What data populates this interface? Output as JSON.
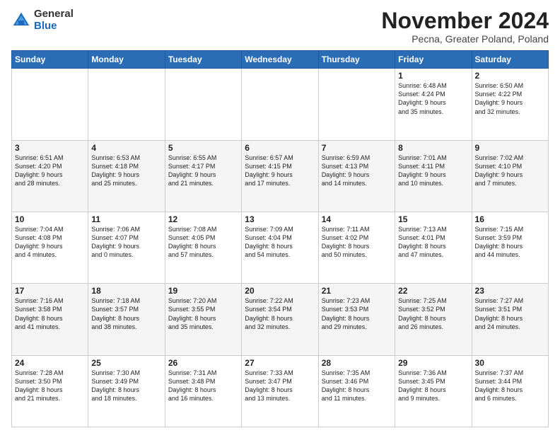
{
  "logo": {
    "general": "General",
    "blue": "Blue"
  },
  "header": {
    "month_title": "November 2024",
    "location": "Pecna, Greater Poland, Poland"
  },
  "days_of_week": [
    "Sunday",
    "Monday",
    "Tuesday",
    "Wednesday",
    "Thursday",
    "Friday",
    "Saturday"
  ],
  "weeks": [
    [
      {
        "day": "",
        "info": ""
      },
      {
        "day": "",
        "info": ""
      },
      {
        "day": "",
        "info": ""
      },
      {
        "day": "",
        "info": ""
      },
      {
        "day": "",
        "info": ""
      },
      {
        "day": "1",
        "info": "Sunrise: 6:48 AM\nSunset: 4:24 PM\nDaylight: 9 hours\nand 35 minutes."
      },
      {
        "day": "2",
        "info": "Sunrise: 6:50 AM\nSunset: 4:22 PM\nDaylight: 9 hours\nand 32 minutes."
      }
    ],
    [
      {
        "day": "3",
        "info": "Sunrise: 6:51 AM\nSunset: 4:20 PM\nDaylight: 9 hours\nand 28 minutes."
      },
      {
        "day": "4",
        "info": "Sunrise: 6:53 AM\nSunset: 4:18 PM\nDaylight: 9 hours\nand 25 minutes."
      },
      {
        "day": "5",
        "info": "Sunrise: 6:55 AM\nSunset: 4:17 PM\nDaylight: 9 hours\nand 21 minutes."
      },
      {
        "day": "6",
        "info": "Sunrise: 6:57 AM\nSunset: 4:15 PM\nDaylight: 9 hours\nand 17 minutes."
      },
      {
        "day": "7",
        "info": "Sunrise: 6:59 AM\nSunset: 4:13 PM\nDaylight: 9 hours\nand 14 minutes."
      },
      {
        "day": "8",
        "info": "Sunrise: 7:01 AM\nSunset: 4:11 PM\nDaylight: 9 hours\nand 10 minutes."
      },
      {
        "day": "9",
        "info": "Sunrise: 7:02 AM\nSunset: 4:10 PM\nDaylight: 9 hours\nand 7 minutes."
      }
    ],
    [
      {
        "day": "10",
        "info": "Sunrise: 7:04 AM\nSunset: 4:08 PM\nDaylight: 9 hours\nand 4 minutes."
      },
      {
        "day": "11",
        "info": "Sunrise: 7:06 AM\nSunset: 4:07 PM\nDaylight: 9 hours\nand 0 minutes."
      },
      {
        "day": "12",
        "info": "Sunrise: 7:08 AM\nSunset: 4:05 PM\nDaylight: 8 hours\nand 57 minutes."
      },
      {
        "day": "13",
        "info": "Sunrise: 7:09 AM\nSunset: 4:04 PM\nDaylight: 8 hours\nand 54 minutes."
      },
      {
        "day": "14",
        "info": "Sunrise: 7:11 AM\nSunset: 4:02 PM\nDaylight: 8 hours\nand 50 minutes."
      },
      {
        "day": "15",
        "info": "Sunrise: 7:13 AM\nSunset: 4:01 PM\nDaylight: 8 hours\nand 47 minutes."
      },
      {
        "day": "16",
        "info": "Sunrise: 7:15 AM\nSunset: 3:59 PM\nDaylight: 8 hours\nand 44 minutes."
      }
    ],
    [
      {
        "day": "17",
        "info": "Sunrise: 7:16 AM\nSunset: 3:58 PM\nDaylight: 8 hours\nand 41 minutes."
      },
      {
        "day": "18",
        "info": "Sunrise: 7:18 AM\nSunset: 3:57 PM\nDaylight: 8 hours\nand 38 minutes."
      },
      {
        "day": "19",
        "info": "Sunrise: 7:20 AM\nSunset: 3:55 PM\nDaylight: 8 hours\nand 35 minutes."
      },
      {
        "day": "20",
        "info": "Sunrise: 7:22 AM\nSunset: 3:54 PM\nDaylight: 8 hours\nand 32 minutes."
      },
      {
        "day": "21",
        "info": "Sunrise: 7:23 AM\nSunset: 3:53 PM\nDaylight: 8 hours\nand 29 minutes."
      },
      {
        "day": "22",
        "info": "Sunrise: 7:25 AM\nSunset: 3:52 PM\nDaylight: 8 hours\nand 26 minutes."
      },
      {
        "day": "23",
        "info": "Sunrise: 7:27 AM\nSunset: 3:51 PM\nDaylight: 8 hours\nand 24 minutes."
      }
    ],
    [
      {
        "day": "24",
        "info": "Sunrise: 7:28 AM\nSunset: 3:50 PM\nDaylight: 8 hours\nand 21 minutes."
      },
      {
        "day": "25",
        "info": "Sunrise: 7:30 AM\nSunset: 3:49 PM\nDaylight: 8 hours\nand 18 minutes."
      },
      {
        "day": "26",
        "info": "Sunrise: 7:31 AM\nSunset: 3:48 PM\nDaylight: 8 hours\nand 16 minutes."
      },
      {
        "day": "27",
        "info": "Sunrise: 7:33 AM\nSunset: 3:47 PM\nDaylight: 8 hours\nand 13 minutes."
      },
      {
        "day": "28",
        "info": "Sunrise: 7:35 AM\nSunset: 3:46 PM\nDaylight: 8 hours\nand 11 minutes."
      },
      {
        "day": "29",
        "info": "Sunrise: 7:36 AM\nSunset: 3:45 PM\nDaylight: 8 hours\nand 9 minutes."
      },
      {
        "day": "30",
        "info": "Sunrise: 7:37 AM\nSunset: 3:44 PM\nDaylight: 8 hours\nand 6 minutes."
      }
    ]
  ]
}
